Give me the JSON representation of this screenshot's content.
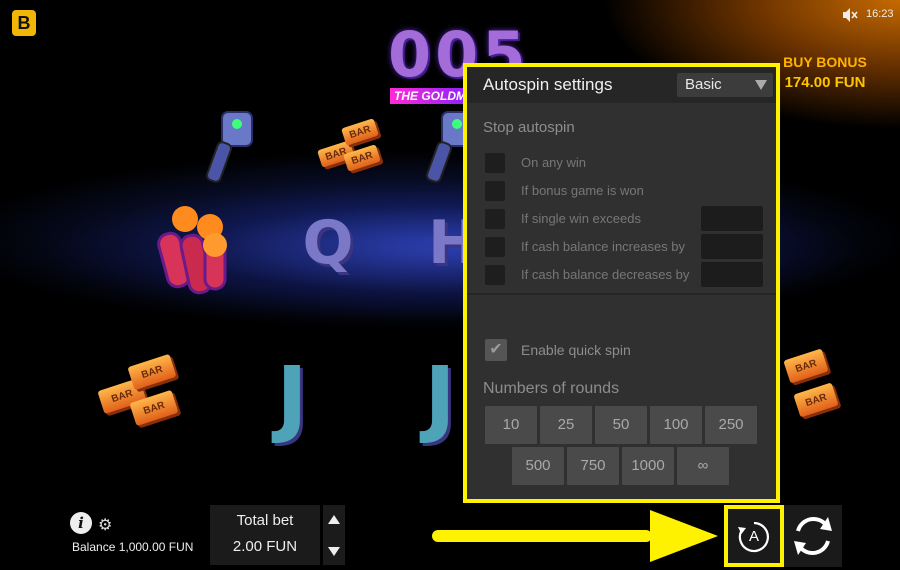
{
  "brand": {
    "logo_letter": "B"
  },
  "status": {
    "time": "16:23",
    "icon": "speaker-muted-icon"
  },
  "game": {
    "title": "005",
    "tagline": "THE GOLDM"
  },
  "buy_bonus": {
    "title": "BUY BONUS",
    "price": "174.00 FUN"
  },
  "reels": {
    "symbols": [
      "drill",
      "bar",
      "drill",
      "dynamite",
      "Q",
      "H",
      "bar",
      "J",
      "J",
      "bar"
    ],
    "bar_text": "BAR"
  },
  "autospin": {
    "title": "Autospin settings",
    "mode": "Basic",
    "stop_title": "Stop autospin",
    "options": [
      {
        "label": "On any win",
        "has_value": false
      },
      {
        "label": "If bonus game is won",
        "has_value": false
      },
      {
        "label": "If single win exceeds",
        "has_value": true
      },
      {
        "label": "If cash balance increases by",
        "has_value": true
      },
      {
        "label": "If cash balance decreases by",
        "has_value": true
      }
    ],
    "quick_spin": {
      "label": "Enable quick spin",
      "checked": true,
      "check": "✔"
    },
    "rounds_title": "Numbers of rounds",
    "rounds": [
      "10",
      "25",
      "50",
      "100",
      "250",
      "500",
      "750",
      "1000",
      "∞"
    ]
  },
  "footer": {
    "info_icon": "i",
    "settings_icon": "⚙",
    "balance": "Balance 1,000.00 FUN",
    "bet_title": "Total bet",
    "bet_value": "2.00 FUN",
    "auto_letter": "A"
  },
  "colors": {
    "highlight": "#fff200",
    "bonus": "#ffb300",
    "panel": "#303030"
  }
}
